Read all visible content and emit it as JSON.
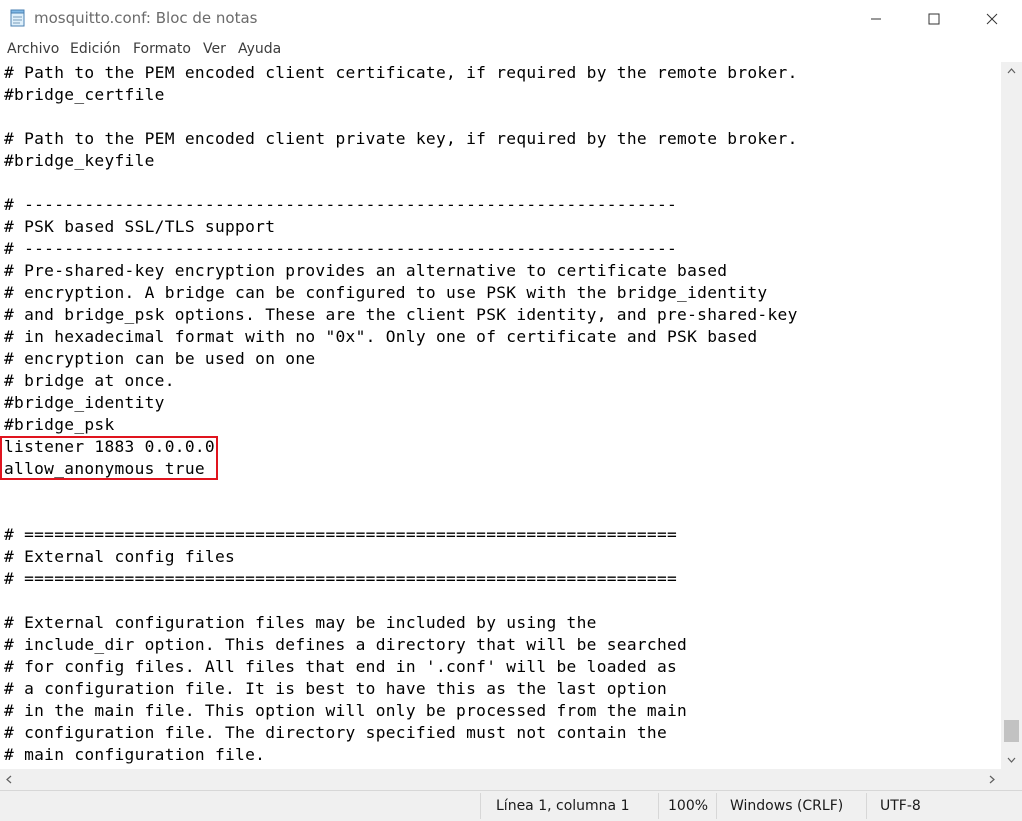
{
  "window": {
    "title": "mosquitto.conf: Bloc de notas",
    "icon": "notepad-icon"
  },
  "controls": {
    "minimize_icon": "minimize-icon",
    "maximize_icon": "maximize-icon",
    "close_icon": "close-icon"
  },
  "menu": {
    "items": [
      "Archivo",
      "Edición",
      "Formato",
      "Ver",
      "Ayuda"
    ]
  },
  "editor": {
    "lines": [
      "# Path to the PEM encoded client certificate, if required by the remote broker.",
      "#bridge_certfile",
      "",
      "# Path to the PEM encoded client private key, if required by the remote broker.",
      "#bridge_keyfile",
      "",
      "# -----------------------------------------------------------------",
      "# PSK based SSL/TLS support",
      "# -----------------------------------------------------------------",
      "# Pre-shared-key encryption provides an alternative to certificate based",
      "# encryption. A bridge can be configured to use PSK with the bridge_identity",
      "# and bridge_psk options. These are the client PSK identity, and pre-shared-key",
      "# in hexadecimal format with no \"0x\". Only one of certificate and PSK based",
      "# encryption can be used on one",
      "# bridge at once.",
      "#bridge_identity",
      "#bridge_psk",
      "listener 1883 0.0.0.0",
      "allow_anonymous true",
      "",
      "",
      "# =================================================================",
      "# External config files",
      "# =================================================================",
      "",
      "# External configuration files may be included by using the",
      "# include_dir option. This defines a directory that will be searched",
      "# for config files. All files that end in '.conf' will be loaded as",
      "# a configuration file. It is best to have this as the last option",
      "# in the main file. This option will only be processed from the main",
      "# configuration file. The directory specified must not contain the",
      "# main configuration file."
    ],
    "highlight_color": "#e0141e"
  },
  "status": {
    "position": "Línea 1, columna 1",
    "zoom": "100%",
    "line_endings": "Windows (CRLF)",
    "encoding": "UTF-8"
  }
}
